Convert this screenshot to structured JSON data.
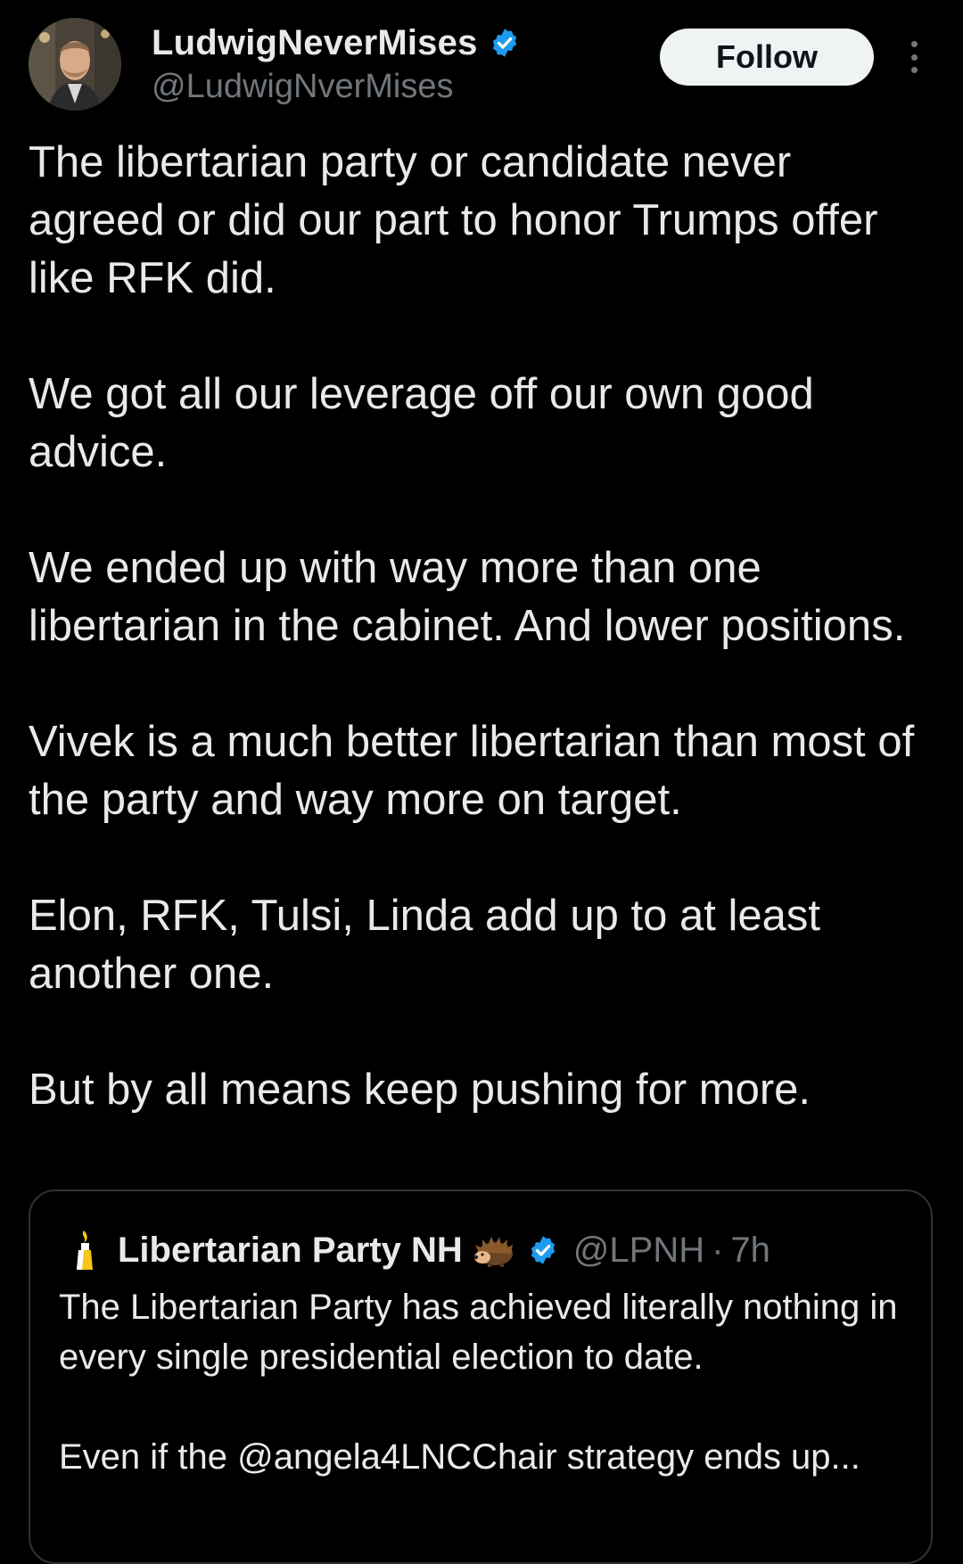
{
  "post": {
    "author": {
      "display_name": "LudwigNeverMises",
      "handle": "@LudwigNverMises",
      "verified": true,
      "avatar_icon": "profile-photo"
    },
    "follow_label": "Follow",
    "more_icon": "more-vertical-icon",
    "paragraphs": [
      "The libertarian party or candidate never agreed or did our part to honor Trumps offer like RFK did.",
      "We got all our leverage off our own good advice.",
      "We ended up with way more than one libertarian in the cabinet. And lower positions.",
      "Vivek is a much better libertarian than most of the party and way more on target.",
      "Elon, RFK, Tulsi, Linda add up to at least another one.",
      "But by all means keep pushing for more."
    ]
  },
  "quoted_post": {
    "author": {
      "display_name": "Libertarian Party NH",
      "handle": "@LPNH",
      "verified": true,
      "avatar_icon": "torch-icon",
      "emoji_icon": "hedgehog-emoji"
    },
    "separator": "·",
    "time": "7h",
    "paragraphs": [
      "The Libertarian Party has achieved literally nothing in every single presidential election to date.",
      "Even if the @angela4LNCChair strategy ends up..."
    ]
  },
  "colors": {
    "background": "#000000",
    "text_primary": "#e7e9ea",
    "text_secondary": "#71767b",
    "verified_blue": "#1d9bf0",
    "follow_bg": "#eff3f4",
    "quote_border": "#2f3336"
  }
}
